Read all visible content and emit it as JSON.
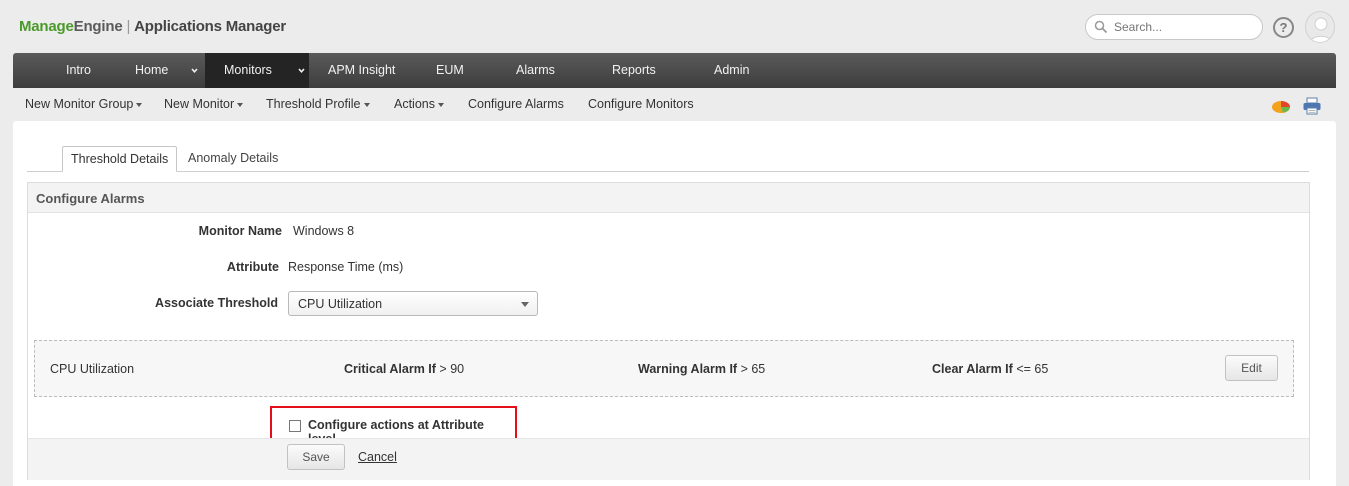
{
  "header": {
    "brand_manage": "Manage",
    "brand_engine": "Engine",
    "separator": "|",
    "app_name": "Applications Manager",
    "search_placeholder": "Search...",
    "help_glyph": "?"
  },
  "main_nav": {
    "items": [
      {
        "label": "Intro"
      },
      {
        "label": "Home"
      },
      {
        "label": "Monitors"
      },
      {
        "label": "APM Insight"
      },
      {
        "label": "EUM"
      },
      {
        "label": "Alarms"
      },
      {
        "label": "Reports"
      },
      {
        "label": "Admin"
      }
    ],
    "active": "Monitors"
  },
  "sub_nav": {
    "items": [
      {
        "label": "New Monitor Group"
      },
      {
        "label": "New Monitor"
      },
      {
        "label": "Threshold Profile"
      },
      {
        "label": "Actions"
      },
      {
        "label": "Configure Alarms"
      },
      {
        "label": "Configure Monitors"
      }
    ]
  },
  "tabs": [
    {
      "label": "Threshold Details"
    },
    {
      "label": "Anomaly Details"
    }
  ],
  "configure": {
    "title": "Configure Alarms",
    "monitor_name_label": "Monitor Name",
    "monitor_name_value": "Windows 8",
    "attribute_label": "Attribute",
    "attribute_value": "Response Time (ms)",
    "associate_threshold_label": "Associate Threshold",
    "associate_threshold_value": "CPU Utilization",
    "threshold_row": {
      "name": "CPU Utilization",
      "critical_label": "Critical Alarm If",
      "critical_value": "> 90",
      "warning_label": "Warning Alarm If",
      "warning_value": "> 65",
      "clear_label": "Clear Alarm If",
      "clear_value": "<= 65",
      "edit_label": "Edit"
    },
    "attribute_level_checkbox_label": "Configure actions at Attribute level",
    "attribute_level_checked": false,
    "save_label": "Save",
    "cancel_label": "Cancel"
  },
  "colors": {
    "brand_green": "#4a9a2a",
    "highlight_red": "#e3101a",
    "nav_dark": "#3d3d3d",
    "nav_active": "#242424"
  }
}
